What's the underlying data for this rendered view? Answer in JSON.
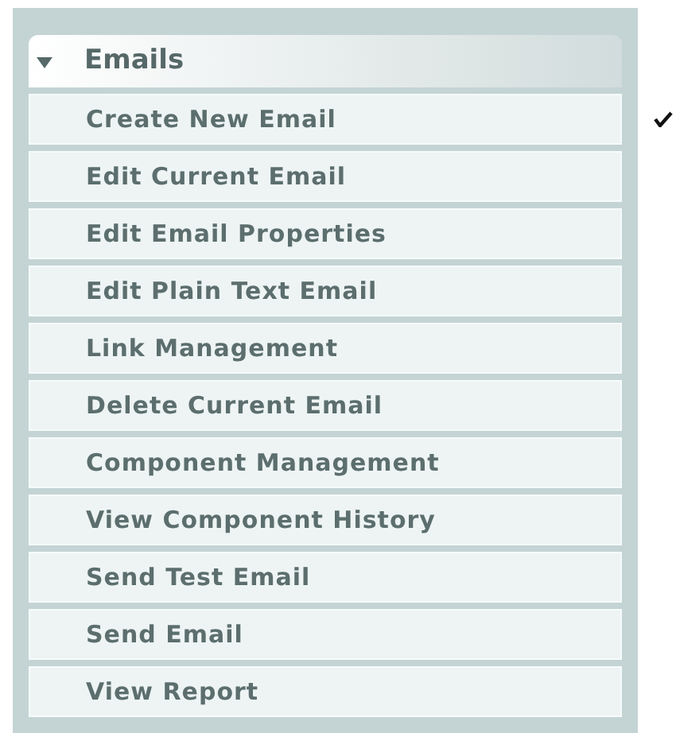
{
  "panel": {
    "title": "Emails",
    "expanded": true,
    "items": [
      {
        "label": "Create New Email",
        "checked": true
      },
      {
        "label": "Edit Current Email",
        "checked": false
      },
      {
        "label": "Edit Email Properties",
        "checked": false
      },
      {
        "label": "Edit Plain Text Email",
        "checked": false
      },
      {
        "label": "Link Management",
        "checked": false
      },
      {
        "label": "Delete Current Email",
        "checked": false
      },
      {
        "label": "Component Management",
        "checked": false
      },
      {
        "label": "View Component History",
        "checked": false
      },
      {
        "label": "Send Test Email",
        "checked": false
      },
      {
        "label": "Send Email",
        "checked": false
      },
      {
        "label": "View Report",
        "checked": false
      }
    ]
  }
}
